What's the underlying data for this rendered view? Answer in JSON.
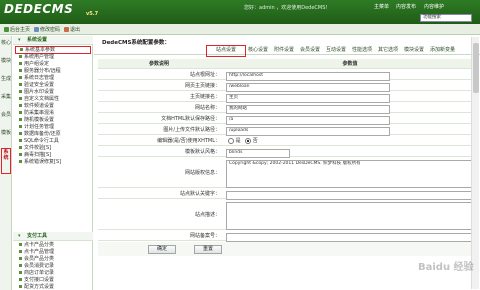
{
  "header": {
    "logo": "DEDECMS",
    "version": "v5.7",
    "userinfo": "您好：admin ，欢迎使用DedeCMS！",
    "nav": [
      "主菜单",
      "内容发布",
      "内容维护"
    ],
    "search_placeholder": "功能搜索"
  },
  "subbar": {
    "links": [
      "后台主页",
      "修改密码",
      "退出"
    ]
  },
  "vtabs": [
    "核心",
    "模块",
    "生成",
    "采集",
    "会员",
    "模板",
    "系统"
  ],
  "sidebar": {
    "sections": [
      {
        "title": "系统设置",
        "items": [
          "系统基本参数",
          "系统用户管理",
          "用户组设定",
          "服务器分布/远程",
          "系统日志管理",
          "验证安全设置",
          "图片水印设置",
          "自定义文档属性",
          "软件频道设置",
          "防采集串混淆",
          "随机模板设置",
          "计划任务管理",
          "数据库备份/还原",
          "SQL命令行工具",
          "文件校验[S]",
          "病毒扫描[S]",
          "系统错误修复[S]"
        ]
      },
      {
        "title": "支付工具",
        "items": [
          "点卡产品分类",
          "点卡产品管理",
          "会员产品分类",
          "会员消费记录",
          "商店订单记录",
          "支付接口设置",
          "配货方式设置"
        ]
      },
      {
        "title": "系统帮助",
        "items": []
      }
    ]
  },
  "main": {
    "title": "DedeCMS系统配置参数：",
    "tabs": [
      "站点设置",
      "核心设置",
      "附件设置",
      "会员设置",
      "互动设置",
      "性能选项",
      "其它选项",
      "模块设置",
      "添加新变量"
    ],
    "table": {
      "header": {
        "name": "参数说明",
        "value": "参数值"
      },
      "rows": [
        {
          "label": "站点根网址：",
          "value": "http://localhost",
          "type": "input"
        },
        {
          "label": "网页主页链接：",
          "value": "/webloan",
          "type": "input"
        },
        {
          "label": "主页链接名：",
          "value": "主页",
          "type": "input"
        },
        {
          "label": "网站名称：",
          "value": "我的网站",
          "type": "input"
        },
        {
          "label": "文档HTML默认保存路径：",
          "value": "/a",
          "type": "input"
        },
        {
          "label": "图片/上传文件默认路径：",
          "value": "/uploads",
          "type": "input"
        },
        {
          "label": "编辑器(是/否)使用XHTML：",
          "value": "",
          "type": "radio",
          "options": [
            "是",
            "否"
          ],
          "selected": 1
        },
        {
          "label": "模板默认风格：",
          "value": "",
          "type": "radio",
          "options": [],
          "selected": -1
        },
        {
          "label": "网站版权信息：",
          "value": "Copyright &copy; 2002-2011  DesDeCMS. 织梦科技 版权所有",
          "type": "textarea"
        },
        {
          "label": "站点默认关键字：",
          "value": "",
          "type": "input"
        },
        {
          "label": "站点描述：",
          "value": "",
          "type": "textarea"
        },
        {
          "label": "网站备案号：",
          "value": "",
          "type": "input"
        }
      ],
      "theme_value": "blinds"
    },
    "buttons": {
      "ok": "确定",
      "reset": "重置"
    }
  },
  "watermark": "Baidu 经验",
  "colors": {
    "header_green": "#2f7b25",
    "highlight_red": "#e0242a",
    "accent_text": "#2e6b21"
  }
}
